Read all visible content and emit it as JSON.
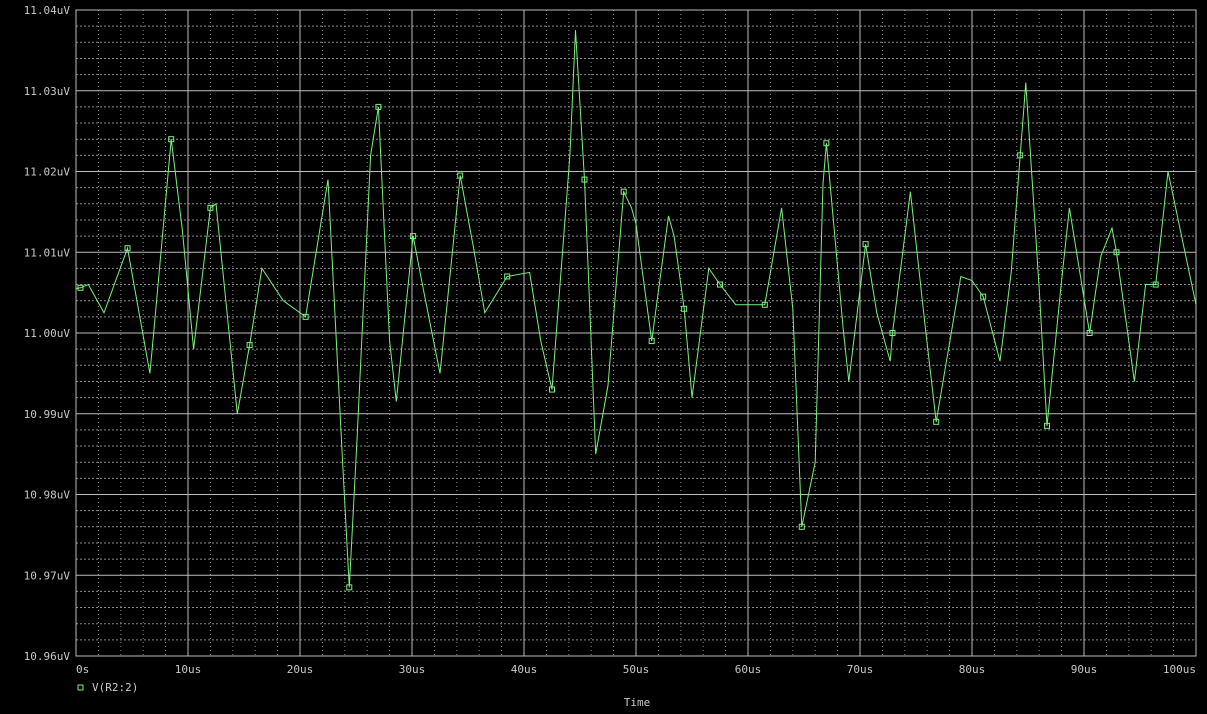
{
  "colors": {
    "background": "#000000",
    "grid": "#bcbcbc",
    "minor_grid": "#8a8a8a",
    "trace": "#7cf07c",
    "text": "#c8c8c8"
  },
  "chart_data": {
    "type": "line",
    "xlabel": "Time",
    "ylabel": "",
    "xlim": [
      0,
      100
    ],
    "ylim": [
      10.96,
      11.04
    ],
    "x_ticks": [
      {
        "value": 0,
        "label": "0s"
      },
      {
        "value": 10,
        "label": "10us"
      },
      {
        "value": 20,
        "label": "20us"
      },
      {
        "value": 30,
        "label": "30us"
      },
      {
        "value": 40,
        "label": "40us"
      },
      {
        "value": 50,
        "label": "50us"
      },
      {
        "value": 60,
        "label": "60us"
      },
      {
        "value": 70,
        "label": "70us"
      },
      {
        "value": 80,
        "label": "80us"
      },
      {
        "value": 90,
        "label": "90us"
      },
      {
        "value": 100,
        "label": "100us"
      }
    ],
    "y_ticks": [
      {
        "value": 10.96,
        "label": "10.96uV"
      },
      {
        "value": 10.97,
        "label": "10.97uV"
      },
      {
        "value": 10.98,
        "label": "10.98uV"
      },
      {
        "value": 10.99,
        "label": "10.99uV"
      },
      {
        "value": 11.0,
        "label": "11.00uV"
      },
      {
        "value": 11.01,
        "label": "11.01uV"
      },
      {
        "value": 11.02,
        "label": "11.02uV"
      },
      {
        "value": 11.03,
        "label": "11.03uV"
      },
      {
        "value": 11.04,
        "label": "11.04uV"
      }
    ],
    "grid": true,
    "legend_position": "bottom-left",
    "series": [
      {
        "name": "V(R2:2)",
        "x": [
          0.0,
          0.4,
          1.1,
          2.5,
          4.6,
          6.6,
          7.0,
          8.5,
          9.5,
          10.5,
          12.0,
          12.5,
          14.4,
          15.5,
          16.6,
          18.5,
          20.5,
          22.5,
          23.8,
          24.4,
          25.1,
          26.3,
          27.0,
          28.0,
          28.6,
          30.1,
          31.0,
          32.5,
          34.3,
          35.5,
          36.5,
          38.5,
          40.5,
          41.5,
          42.5,
          44.1,
          44.6,
          45.4,
          46.4,
          47.5,
          48.9,
          49.6,
          50.0,
          51.4,
          52.9,
          53.4,
          54.3,
          55.0,
          56.5,
          57.5,
          58.9,
          60.0,
          61.5,
          63.0,
          64.0,
          64.8,
          66.0,
          66.7,
          67.0,
          68.5,
          69.0,
          70.5,
          71.5,
          72.7,
          72.9,
          74.5,
          75.8,
          76.8,
          79.0,
          80.0,
          81.0,
          82.5,
          83.5,
          84.3,
          84.8,
          86.0,
          86.7,
          88.0,
          88.7,
          90.5,
          91.5,
          92.5,
          92.9,
          94.5,
          95.5,
          96.4,
          97.5,
          100.0
        ],
        "values": [
          11.0055,
          11.0056,
          11.006,
          11.0025,
          11.0105,
          10.995,
          11.001,
          11.024,
          11.0127,
          10.998,
          11.0155,
          11.016,
          10.99,
          10.9985,
          11.008,
          11.004,
          11.002,
          11.019,
          10.984,
          10.9685,
          10.987,
          11.022,
          11.028,
          10.999,
          10.9915,
          11.012,
          11.0055,
          10.995,
          11.0195,
          11.0105,
          11.0025,
          11.007,
          11.0075,
          10.999,
          10.993,
          11.022,
          11.0375,
          11.019,
          10.985,
          10.9935,
          11.0175,
          11.0155,
          11.0135,
          10.999,
          11.0145,
          11.012,
          11.003,
          10.992,
          11.008,
          11.006,
          11.0035,
          11.0035,
          11.0035,
          11.0155,
          11.003,
          10.976,
          10.984,
          11.0185,
          11.0235,
          11.0005,
          10.994,
          11.011,
          11.0025,
          10.9965,
          11.0,
          11.0175,
          11.001,
          10.989,
          11.007,
          11.0065,
          11.0045,
          10.9965,
          11.0075,
          11.022,
          11.031,
          11.0055,
          10.9885,
          11.0065,
          11.0155,
          11.0,
          11.0095,
          11.013,
          11.01,
          10.994,
          11.006,
          11.006,
          11.02,
          11.0035
        ]
      }
    ]
  }
}
